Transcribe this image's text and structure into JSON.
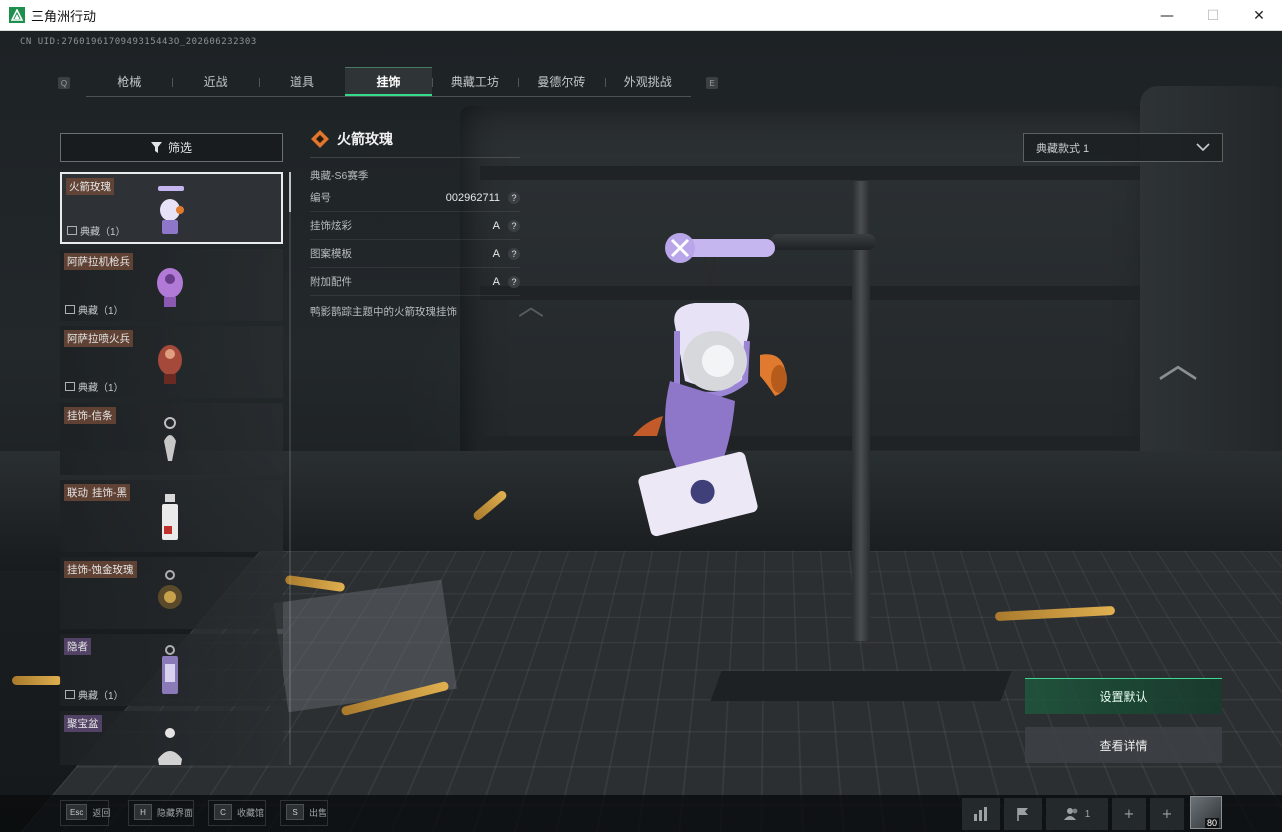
{
  "window": {
    "title": "三角洲行动",
    "controls": {
      "minimize": "—",
      "maximize": "☐",
      "close": "✕"
    }
  },
  "uid": "CN UID:2760196170949315443O_202606232303",
  "tab_hints": {
    "left": "Q",
    "right": "E"
  },
  "tabs": [
    {
      "label": "枪械",
      "active": false
    },
    {
      "label": "近战",
      "active": false
    },
    {
      "label": "道具",
      "active": false
    },
    {
      "label": "挂饰",
      "active": true
    },
    {
      "label": "典藏工坊",
      "active": false
    },
    {
      "label": "曼德尔砖",
      "active": false
    },
    {
      "label": "外观挑战",
      "active": false
    }
  ],
  "filter": {
    "label": "筛选",
    "icon": "filter-icon"
  },
  "items": [
    {
      "name": "火箭玫瑰",
      "meta": "典藏（1）",
      "selected": true,
      "tag_style": "plain"
    },
    {
      "name": "阿萨拉机枪兵",
      "meta": "典藏（1）",
      "selected": false,
      "tag_style": "plain"
    },
    {
      "name": "阿萨拉喷火兵",
      "meta": "典藏（1）",
      "selected": false,
      "tag_style": "plain"
    },
    {
      "name": "挂饰-信条",
      "meta": "",
      "selected": false,
      "tag_style": "plain"
    },
    {
      "prefix": "联动",
      "name": "挂饰-黑",
      "meta": "",
      "selected": false,
      "tag_style": "plain"
    },
    {
      "name": "挂饰-蚀金玫瑰",
      "meta": "",
      "selected": false,
      "tag_style": "plain"
    },
    {
      "name": "隐者",
      "meta": "典藏（1）",
      "selected": false,
      "tag_style": "purple"
    },
    {
      "name": "聚宝盆",
      "meta": "",
      "selected": false,
      "tag_style": "purple"
    }
  ],
  "detail": {
    "title": "火箭玫瑰",
    "season": "典藏-S6赛季",
    "rows": [
      {
        "label": "编号",
        "value": "002962711"
      },
      {
        "label": "挂饰炫彩",
        "value": "A"
      },
      {
        "label": "图案模板",
        "value": "A"
      },
      {
        "label": "附加配件",
        "value": "A"
      }
    ],
    "help": "?",
    "description": "鸭影鹊踪主题中的火箭玫瑰挂饰"
  },
  "style_select": {
    "value": "典藏款式 1"
  },
  "actions": {
    "set_default": "设置默认",
    "view_details": "查看详情"
  },
  "bottom_hints": [
    {
      "key": "Esc",
      "label": "返回"
    },
    {
      "key": "H",
      "label": "隐藏界面"
    },
    {
      "key": "C",
      "label": "收藏馆"
    },
    {
      "key": "S",
      "label": "出售"
    }
  ],
  "bottom_right": {
    "friends_count": "1",
    "plus": "+",
    "level": "80"
  },
  "colors": {
    "accent": "#37d98a",
    "tag_brown": "#6c4838",
    "tag_purple": "#58466e",
    "charm_lavender": "#c6b6f0",
    "charm_orange": "#e07a2e"
  }
}
